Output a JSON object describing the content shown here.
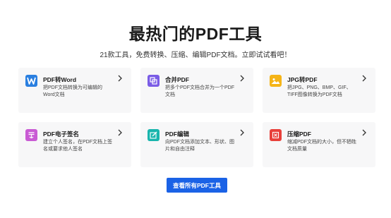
{
  "header": {
    "title": "最热门的PDF工具",
    "subtitle": "21款工具，免费转换、压缩、编辑PDF文档。立即试试看吧！"
  },
  "tools": [
    {
      "name": "PDF转Word",
      "desc": "把PDF文档转换为可编辑的Word文档",
      "icon": "word-icon",
      "color": "#2a7fe0"
    },
    {
      "name": "合并PDF",
      "desc": "把多个PDF文档合并为一个PDF文档",
      "icon": "merge-icon",
      "color": "#7a5ce6"
    },
    {
      "name": "JPG转PDF",
      "desc": "把JPG、PNG、BMP、GIF、TIFF图像转换为PDF文档",
      "icon": "image-icon",
      "color": "#f5b417"
    },
    {
      "name": "PDF电子签名",
      "desc": "建立个人签名，在PDF文档上签名或要求他人签名",
      "icon": "signature-icon",
      "color": "#c95bd4"
    },
    {
      "name": "PDF编辑",
      "desc": "向PDF文档添加文本、形状、图片和自由注释",
      "icon": "edit-icon",
      "color": "#19b5ad"
    },
    {
      "name": "压缩PDF",
      "desc": "缩减PDF文档的大小，但不牺牲文档质量",
      "icon": "compress-icon",
      "color": "#e8403a"
    }
  ],
  "cta": {
    "label": "查看所有PDF工具",
    "color": "#1a62e6"
  }
}
